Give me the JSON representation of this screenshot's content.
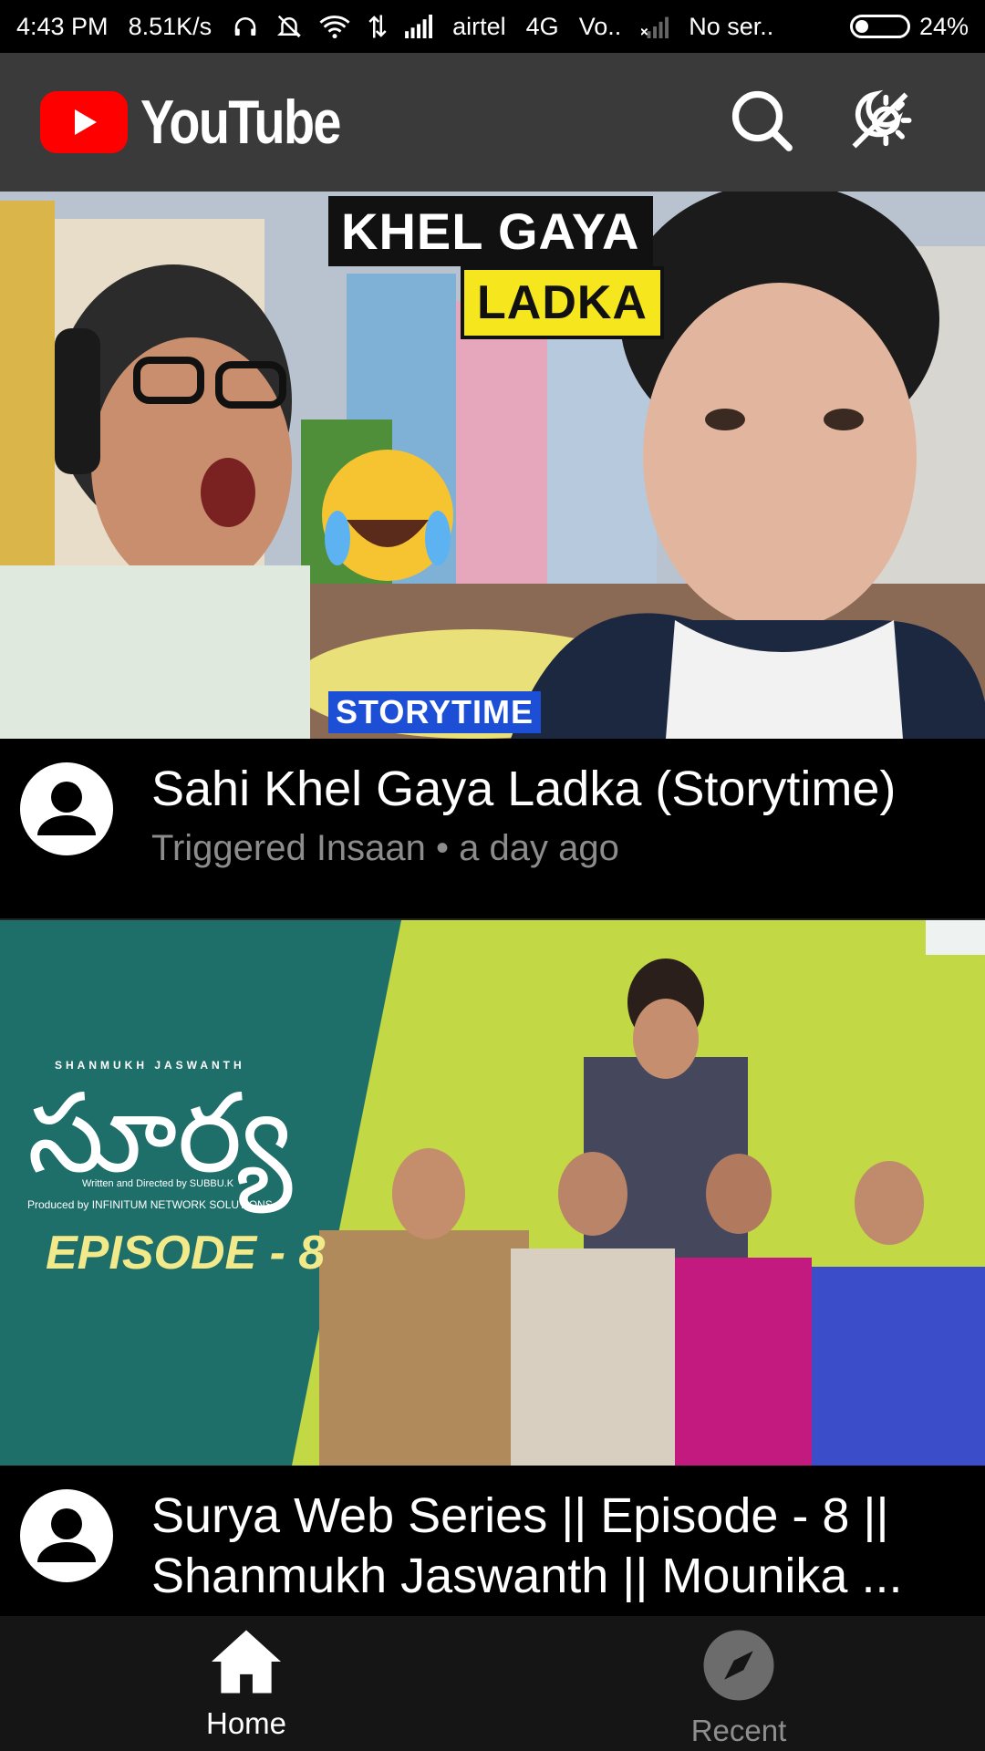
{
  "status_bar": {
    "time": "4:43 PM",
    "speed": "8.51K/s",
    "carrier": "airtel",
    "network": "4G",
    "volte": "Vo..",
    "no_service": "No ser..",
    "battery": "24%",
    "icons": [
      "headphones-icon",
      "mute-icon",
      "wifi-icon",
      "data-icon",
      "signal-icon",
      "no-signal-icon",
      "battery-icon"
    ]
  },
  "header": {
    "brand": "YouTube",
    "accent": "#ff0000",
    "icons": [
      "search-icon",
      "theme-toggle-icon"
    ]
  },
  "videos": [
    {
      "thumbnail_text": [
        "KHEL GAYA",
        "LADKA",
        "STORYTIME"
      ],
      "title": "Sahi Khel Gaya Ladka (Storytime)",
      "subtitle": "Triggered Insaan • a day ago"
    },
    {
      "thumbnail_text": [
        "SHANMUKH JASWANTH",
        "సూర్య",
        "Written and Directed by SUBBU.K",
        "Produced by INFINITUM NETWORK SOLUTIONS",
        "EPISODE - 8"
      ],
      "title_line1": "Surya Web Series || Episode - 8 ||",
      "title_line2": "Shanmukh Jaswanth || Mounika ..."
    }
  ],
  "bottom_nav": {
    "home": "Home",
    "recent": "Recent"
  }
}
